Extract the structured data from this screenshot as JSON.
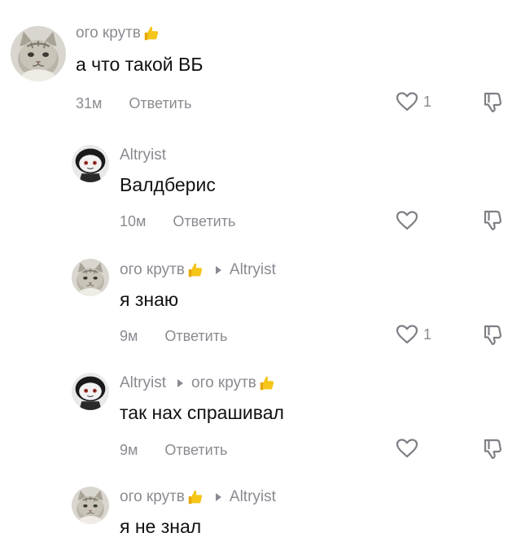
{
  "comments": [
    {
      "author": "ого крутв",
      "author_emoji": "thumbs-up-icon",
      "reply_to": "",
      "text": "а что такой ВБ",
      "time": "31м",
      "reply_label": "Ответить",
      "likes": "1",
      "avatar": "cat"
    },
    {
      "author": "Altryist",
      "author_emoji": "",
      "reply_to": "",
      "text": "Валдберис",
      "time": "10м",
      "reply_label": "Ответить",
      "likes": "",
      "avatar": "character"
    },
    {
      "author": "ого крутв",
      "author_emoji": "thumbs-up-icon",
      "reply_to": "Altryist",
      "text": "я знаю",
      "time": "9м",
      "reply_label": "Ответить",
      "likes": "1",
      "avatar": "cat"
    },
    {
      "author": "Altryist",
      "author_emoji": "",
      "reply_to": "ого крутв",
      "reply_to_emoji": "thumbs-up-icon",
      "text": "так нах спрашивал",
      "time": "9м",
      "reply_label": "Ответить",
      "likes": "",
      "avatar": "character"
    },
    {
      "author": "ого крутв",
      "author_emoji": "thumbs-up-icon",
      "reply_to": "Altryist",
      "text": "я не знал",
      "time": "",
      "reply_label": "",
      "likes": "",
      "avatar": "cat"
    }
  ],
  "colors": {
    "secondary_text": "#8a8b91",
    "primary_text": "#111111",
    "thumb_emoji": "#f5c518"
  }
}
